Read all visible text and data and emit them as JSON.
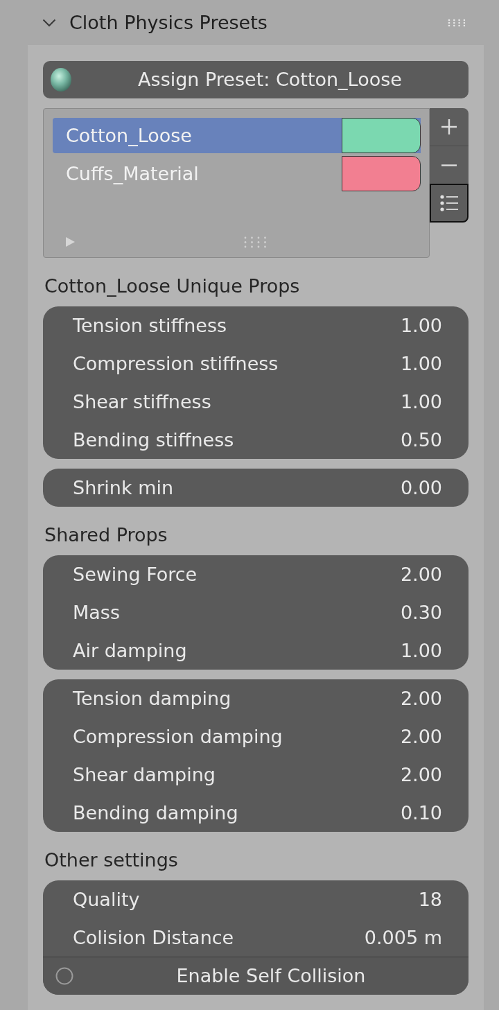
{
  "header": {
    "title": "Cloth Physics Presets",
    "expanded": true
  },
  "assign_button": {
    "label": "Assign Preset: Cotton_Loose"
  },
  "preset_list": {
    "items": [
      {
        "name": "Cotton_Loose",
        "selected": true,
        "color": "#7bd8b0"
      },
      {
        "name": "Cuffs_Material",
        "selected": false,
        "color": "#f27f91"
      }
    ]
  },
  "sections": [
    {
      "heading": "Cotton_Loose Unique Props",
      "groups": [
        {
          "rows": [
            {
              "kind": "value",
              "label": "Tension stiffness",
              "value": "1.00"
            },
            {
              "kind": "value",
              "label": "Compression stiffness",
              "value": "1.00"
            },
            {
              "kind": "value",
              "label": "Shear stiffness",
              "value": "1.00"
            },
            {
              "kind": "value",
              "label": "Bending stiffness",
              "value": "0.50"
            }
          ]
        },
        {
          "rows": [
            {
              "kind": "value",
              "label": "Shrink min",
              "value": "0.00"
            }
          ]
        }
      ]
    },
    {
      "heading": "Shared Props",
      "groups": [
        {
          "rows": [
            {
              "kind": "value",
              "label": "Sewing Force",
              "value": "2.00"
            },
            {
              "kind": "value",
              "label": "Mass",
              "value": "0.30"
            },
            {
              "kind": "value",
              "label": "Air damping",
              "value": "1.00"
            }
          ]
        },
        {
          "rows": [
            {
              "kind": "value",
              "label": "Tension damping",
              "value": "2.00"
            },
            {
              "kind": "value",
              "label": "Compression damping",
              "value": "2.00"
            },
            {
              "kind": "value",
              "label": "Shear damping",
              "value": "2.00"
            },
            {
              "kind": "value",
              "label": "Bending damping",
              "value": "0.10"
            }
          ]
        }
      ]
    },
    {
      "heading": "Other settings",
      "groups": [
        {
          "rows": [
            {
              "kind": "value",
              "label": "Quality",
              "value": "18"
            },
            {
              "kind": "value",
              "label": "Colision Distance",
              "value": "0.005 m"
            },
            {
              "kind": "checkbox",
              "label": "Enable Self Collision",
              "checked": false
            }
          ]
        }
      ]
    }
  ]
}
